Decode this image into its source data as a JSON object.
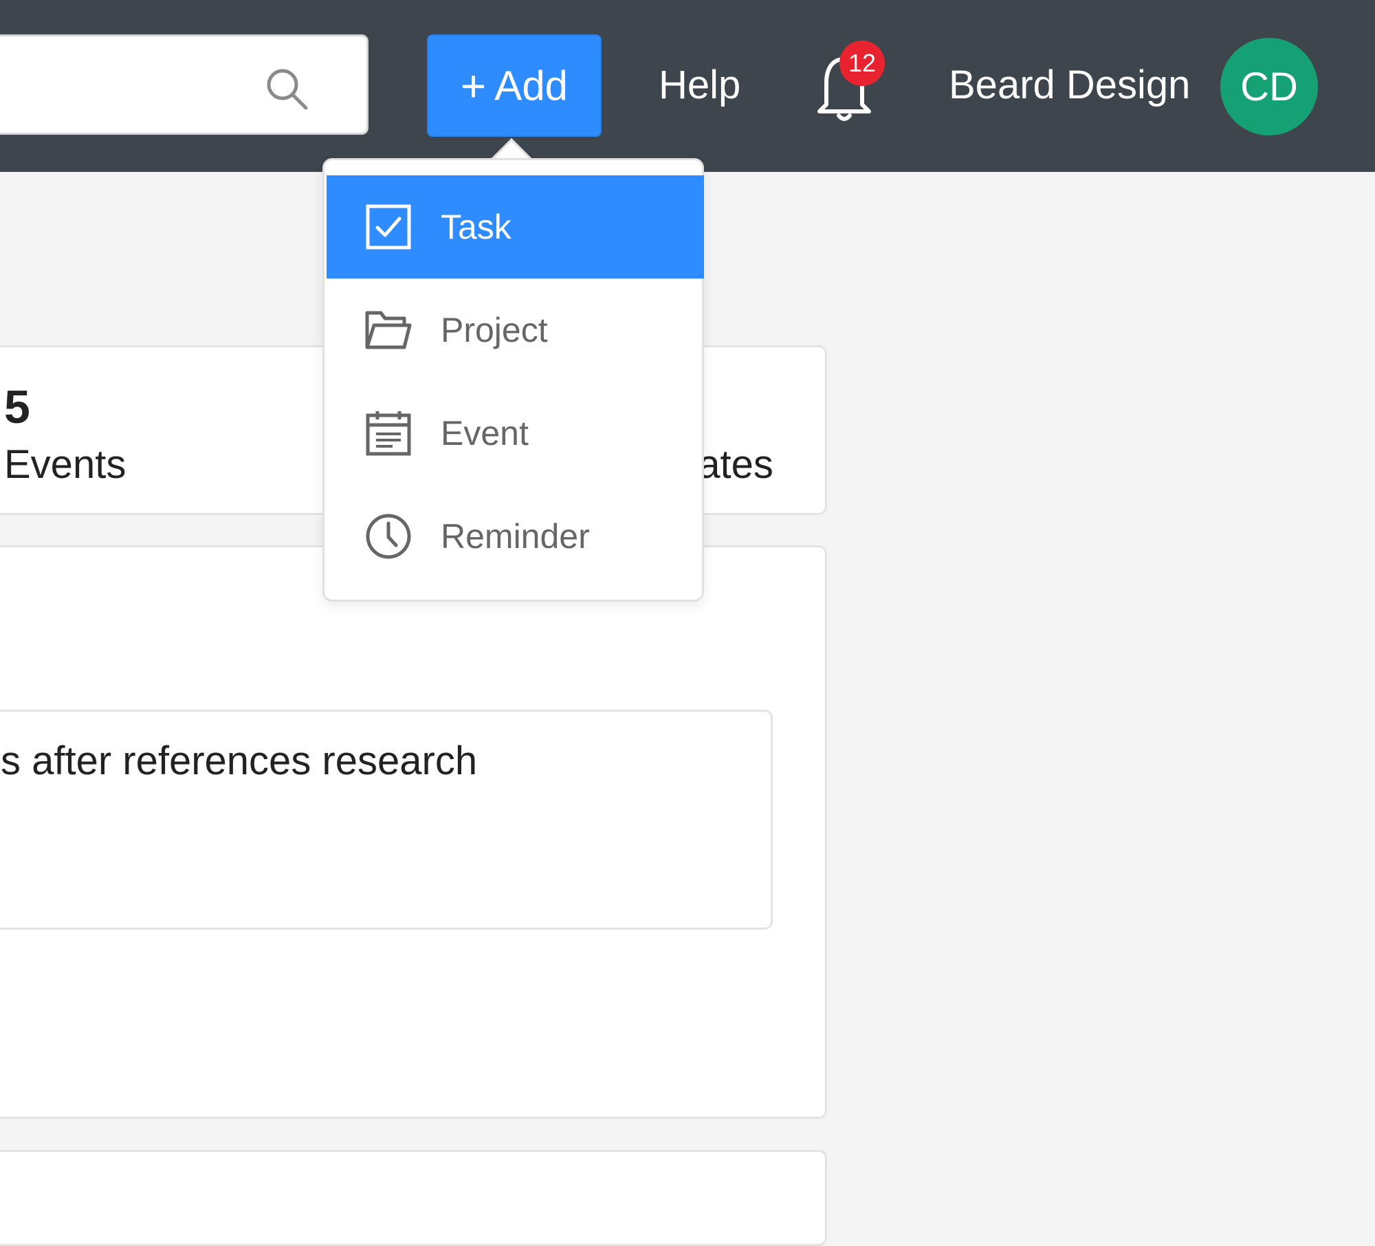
{
  "header": {
    "search": {
      "value": "",
      "placeholder": ""
    },
    "add_label": "Add",
    "help_label": "Help",
    "notification_count": "12",
    "workspace_name": "Beard Design",
    "avatar_initials": "CD"
  },
  "add_menu": {
    "items": [
      {
        "label": "Task",
        "icon": "checkbox-icon",
        "active": true
      },
      {
        "label": "Project",
        "icon": "folder-icon",
        "active": false
      },
      {
        "label": "Event",
        "icon": "calendar-icon",
        "active": false
      },
      {
        "label": "Reminder",
        "icon": "clock-icon",
        "active": false
      }
    ]
  },
  "stats": {
    "count": "5",
    "label": "Events",
    "right_label_fragment": "dates"
  },
  "main": {
    "item_text": "s after references research"
  },
  "colors": {
    "topbar": "#3f454d",
    "accent": "#2f8cff",
    "badge": "#e8222f",
    "avatar": "#16a174",
    "background": "#f4f4f4"
  }
}
